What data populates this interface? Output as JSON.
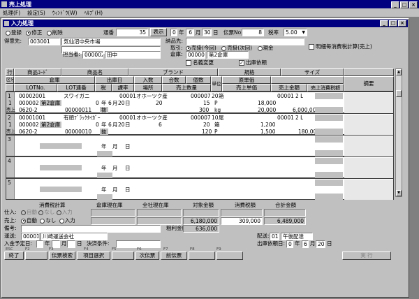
{
  "app_title": "売上処理",
  "menu": [
    "処理(F)",
    "設定(S)",
    "ｳｨﾝﾄﾞｳ(W)",
    "ﾍﾙﾌﾟ(H)"
  ],
  "child_title": "入力処理",
  "mode": {
    "options": [
      "登録",
      "修正",
      "削除"
    ],
    "selected": 1
  },
  "slip_no_label": "通番",
  "slip_no": "35",
  "display_button": "表示",
  "date": {
    "era_prefix": "0",
    "year_unit": "年",
    "month": "6",
    "month_unit": "月",
    "day": "30",
    "day_unit": "日"
  },
  "slip_type_label": "伝票No",
  "slip_type": "8",
  "tax_rate_label": "税率",
  "tax_rate": "5.00",
  "customer_label": "得意先:",
  "customer_code": "003001",
  "customer_name": "気仙沼中央市場",
  "delivery_label": "納品先:",
  "trade_label": "取引:",
  "trade_options": [
    "売掛(今回)",
    "売掛(次回)",
    "現金"
  ],
  "detail_tax_label": "明細毎消費税計算(売上)",
  "staff_label": "担当者:",
  "staff_code": "000002",
  "staff_name": "田中",
  "warehouse_label": "倉庫:",
  "warehouse_code": "000002",
  "warehouse_name": "第2倉庫",
  "name_change_label": "名義変更",
  "ship_request_label": "出庫依頼",
  "header_row1": [
    "行",
    "商品ｺｰﾄﾞ",
    "商品名",
    "ブランド",
    "規格",
    "サイズ"
  ],
  "header_row2": [
    "区分",
    "倉庫",
    "出庫日",
    "入数",
    "合数",
    "個数",
    "単位",
    "原単価",
    "",
    "摘要"
  ],
  "header_row3": [
    "LOTNo.",
    "LOT連番",
    "税",
    "課率",
    "場所",
    "売上数量",
    "売上単価",
    "売上金額",
    "売上消費税額"
  ],
  "rows": [
    {
      "no": "1",
      "kbn": "1",
      "type": "売上",
      "code": "00002001",
      "name": "スワイガニ",
      "maker": "00001",
      "brand": "オホーツク産",
      "spec": "000007",
      "spec_unit": "20",
      "size_code": "00001",
      "size_name": "2 L",
      "warehouse_code": "000002",
      "warehouse_name": "第2倉庫",
      "ship_era": "0",
      "ship_year_unit": "年",
      "ship_month": "6",
      "ship_month_unit": "月",
      "ship_day": "20",
      "ship_day_unit": "日",
      "irisu": "20",
      "kosu": "15",
      "unit": "P",
      "cost": "18,000",
      "lot": "0620-2",
      "lot_seq": "00000011",
      "tax": "抜",
      "qty": "300",
      "qty_unit": "kg",
      "price": "20,000",
      "amount": "6,000,000",
      "unit_a": "箱"
    },
    {
      "no": "2",
      "kbn": "1",
      "type": "売上",
      "code": "00001001",
      "name": "有頭ﾌﾞﾗｯｸﾀｲｶﾞｰ",
      "maker": "00001",
      "brand": "オホーツク産",
      "spec": "000007",
      "spec_unit": "10",
      "size_code": "00001",
      "size_name": "2 L",
      "warehouse_code": "000002",
      "warehouse_name": "第2倉庫",
      "ship_era": "0",
      "ship_year_unit": "年",
      "ship_month": "6",
      "ship_month_unit": "月",
      "ship_day": "20",
      "ship_day_unit": "日",
      "irisu": "6",
      "kosu": "20",
      "unit": "箱",
      "cost": "1,200",
      "lot": "0620-2",
      "lot_seq": "00000010",
      "tax": "抜",
      "qty": "120",
      "qty_unit": "P",
      "price": "1,500",
      "amount": "180,000",
      "unit_a": "尾"
    }
  ],
  "empty_rows": [
    "3",
    "4",
    "5"
  ],
  "empty_date": {
    "year": "年",
    "month": "月",
    "day": "日"
  },
  "summary_headers": [
    "消費税計算",
    "倉庫現在庫",
    "全社現在庫",
    "対象金額",
    "消費税額",
    "合計金額"
  ],
  "purchase_label": "仕入:",
  "sales_label": "売上:",
  "tax_calc_options": [
    "自動",
    "なし",
    "入力"
  ],
  "target_amount": "6,180,000",
  "tax_amount": "309,000",
  "total_amount": "6,489,000",
  "gross_label": "粗利金額:",
  "gross_amount": "636,000",
  "remarks_label": "備考:",
  "carrier_label": "運送:",
  "carrier_code": "00001",
  "carrier_name": "川崎運送会社",
  "delivery_info_label": "配送:",
  "delivery_info_code": "01",
  "delivery_info_name": "午後配達",
  "payment_date_label": "入金予定日:",
  "pay_era": "",
  "pay_year_unit": "年",
  "pay_month_unit": "月",
  "pay_day_unit": "日",
  "settlement_label": "決済条件:",
  "ship_date_label": "出庫依頼日:",
  "ship_date": {
    "era": "0",
    "year_unit": "年",
    "month": "6",
    "month_unit": "月",
    "day": "20",
    "day_unit": "日"
  },
  "fkeys": [
    "ESC",
    "F2",
    "F3",
    "F4",
    "F5",
    "F6",
    "F7",
    "F8",
    "F9"
  ],
  "buttons": {
    "end": "終了",
    "search": "伝票検索",
    "item_select": "項目選択",
    "next": "次伝票",
    "prev": "前伝票",
    "execute": "実 行"
  }
}
